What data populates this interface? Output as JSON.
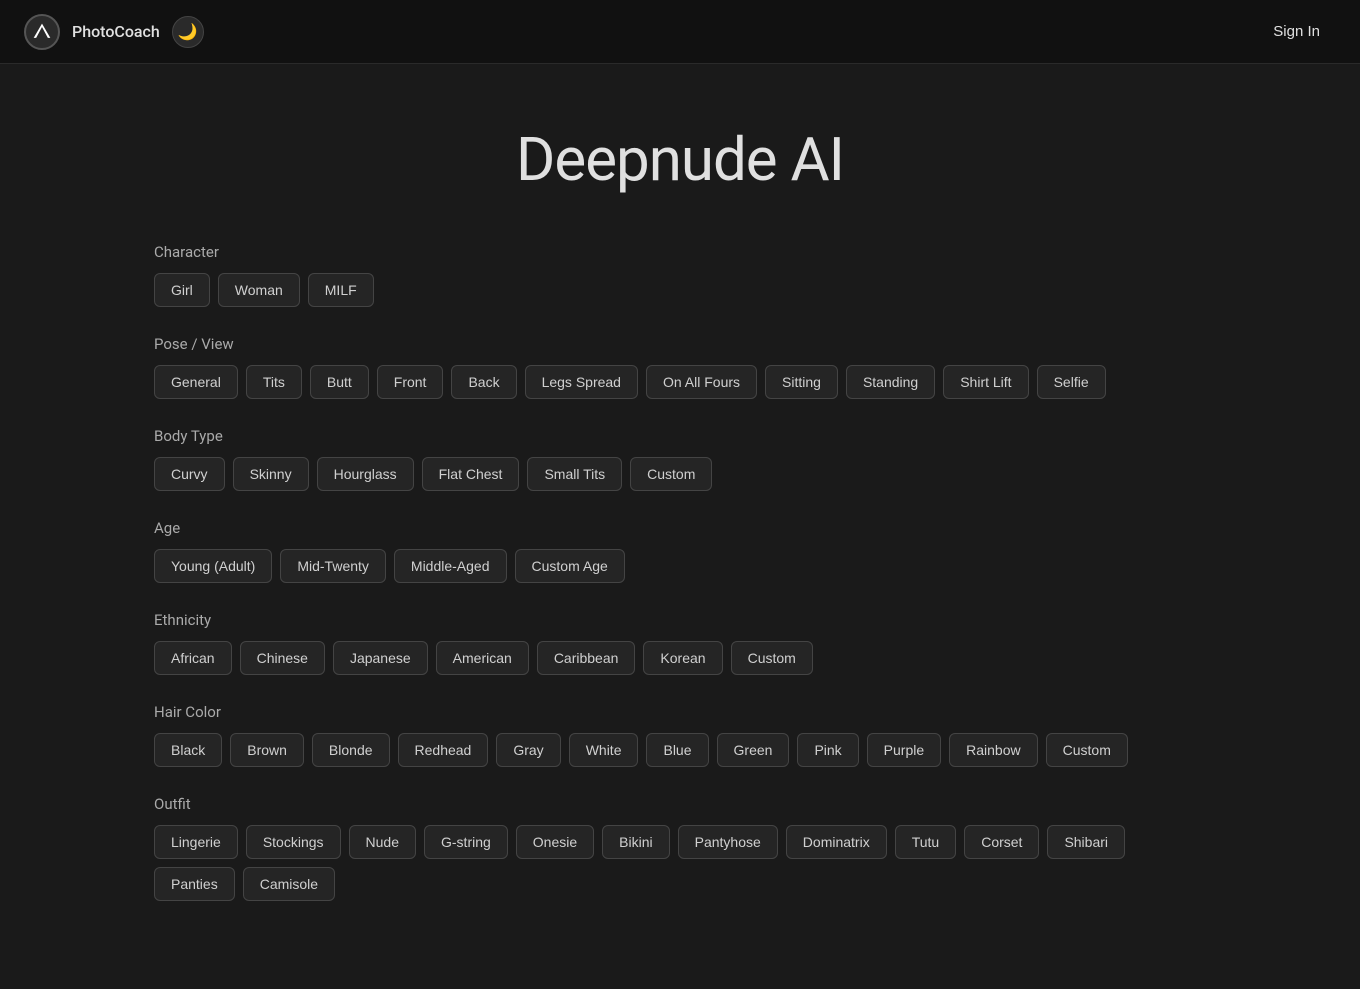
{
  "brand": {
    "name": "PhotoCoach",
    "theme_icon": "🌙",
    "sign_in_label": "Sign In"
  },
  "page": {
    "title": "Deepnude AI"
  },
  "sections": [
    {
      "id": "character",
      "label": "Character",
      "tags": [
        "Girl",
        "Woman",
        "MILF"
      ]
    },
    {
      "id": "pose",
      "label": "Pose / View",
      "tags": [
        "General",
        "Tits",
        "Butt",
        "Front",
        "Back",
        "Legs Spread",
        "On All Fours",
        "Sitting",
        "Standing",
        "Shirt Lift",
        "Selfie"
      ]
    },
    {
      "id": "body-type",
      "label": "Body Type",
      "tags": [
        "Curvy",
        "Skinny",
        "Hourglass",
        "Flat Chest",
        "Small Tits",
        "Custom"
      ]
    },
    {
      "id": "age",
      "label": "Age",
      "tags": [
        "Young (Adult)",
        "Mid-Twenty",
        "Middle-Aged",
        "Custom Age"
      ]
    },
    {
      "id": "ethnicity",
      "label": "Ethnicity",
      "tags": [
        "African",
        "Chinese",
        "Japanese",
        "American",
        "Caribbean",
        "Korean",
        "Custom"
      ]
    },
    {
      "id": "hair-color",
      "label": "Hair Color",
      "tags": [
        "Black",
        "Brown",
        "Blonde",
        "Redhead",
        "Gray",
        "White",
        "Blue",
        "Green",
        "Pink",
        "Purple",
        "Rainbow",
        "Custom"
      ]
    },
    {
      "id": "outfit",
      "label": "Outfit",
      "tags": [
        "Lingerie",
        "Stockings",
        "Nude",
        "G-string",
        "Onesie",
        "Bikini",
        "Pantyhose",
        "Dominatrix",
        "Tutu",
        "Corset",
        "Shibari",
        "Panties",
        "Camisole"
      ]
    }
  ]
}
